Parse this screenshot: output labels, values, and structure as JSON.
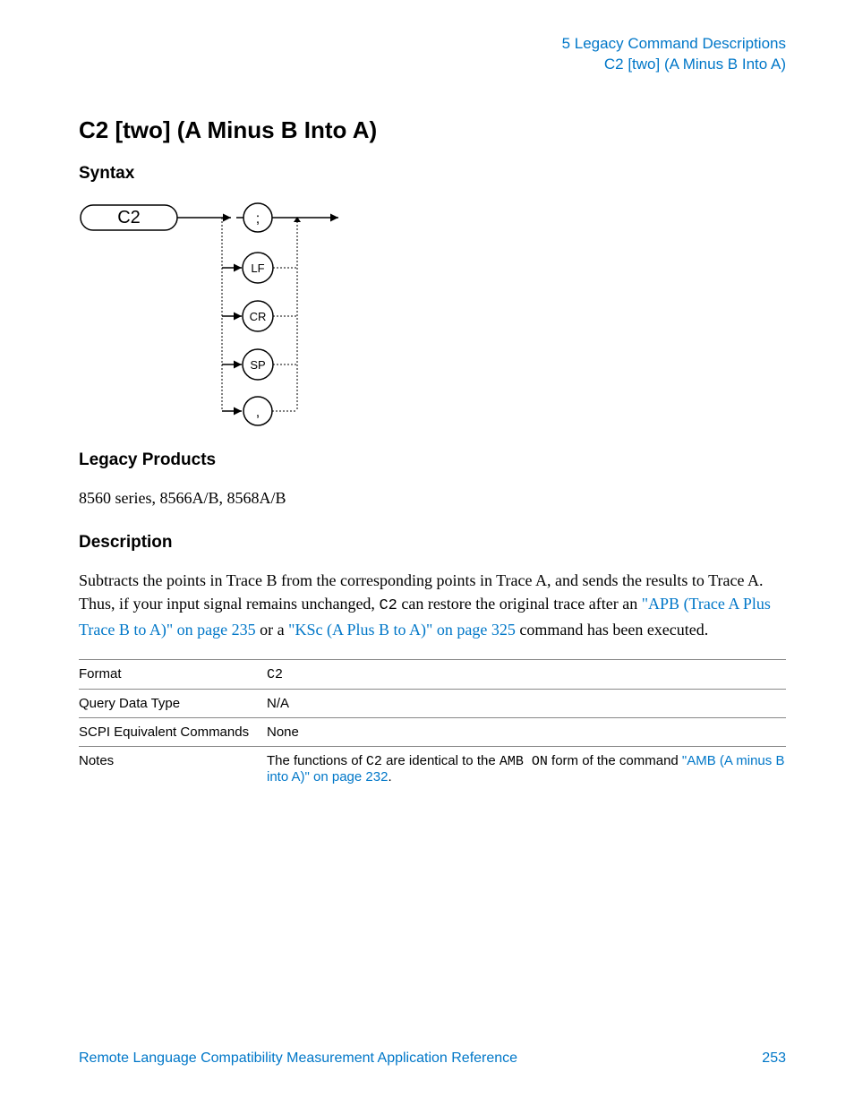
{
  "header": {
    "line1": "5  Legacy Command Descriptions",
    "line2": "C2 [two] (A Minus B Into A)"
  },
  "title": "C2 [two] (A Minus B Into A)",
  "sections": {
    "syntax": "Syntax",
    "legacy_products": "Legacy Products",
    "description": "Description"
  },
  "syntax_diagram": {
    "start": "C2",
    "options": [
      ";",
      "LF",
      "CR",
      "SP",
      ","
    ]
  },
  "legacy_products_text": "8560 series, 8566A/B, 8568A/B",
  "description_parts": {
    "p1": "Subtracts the points in Trace B from the corresponding points in Trace A, and sends the results to Trace A. Thus, if your input signal remains unchanged, ",
    "code1": "C2",
    "p2": " can restore the original trace after an ",
    "link1": "\"APB (Trace A Plus Trace B to A)\" on page 235",
    "p3": " or a ",
    "link2": "\"KSc (A Plus B to A)\" on page 325",
    "p4": " command has been executed."
  },
  "table": {
    "rows": [
      {
        "label": "Format",
        "value_code": "C2"
      },
      {
        "label": "Query Data Type",
        "value": "N/A"
      },
      {
        "label": "SCPI Equivalent Commands",
        "value": "None"
      },
      {
        "label": "Notes",
        "value_parts": {
          "t1": "The functions of ",
          "c1": "C2",
          "t2": " are identical to the ",
          "c2": "AMB ON",
          "t3": " form of the command ",
          "link": "\"AMB (A minus B into A)\" on page 232",
          "t4": "."
        }
      }
    ]
  },
  "footer": {
    "left": "Remote Language Compatibility Measurement Application Reference",
    "page": "253"
  }
}
